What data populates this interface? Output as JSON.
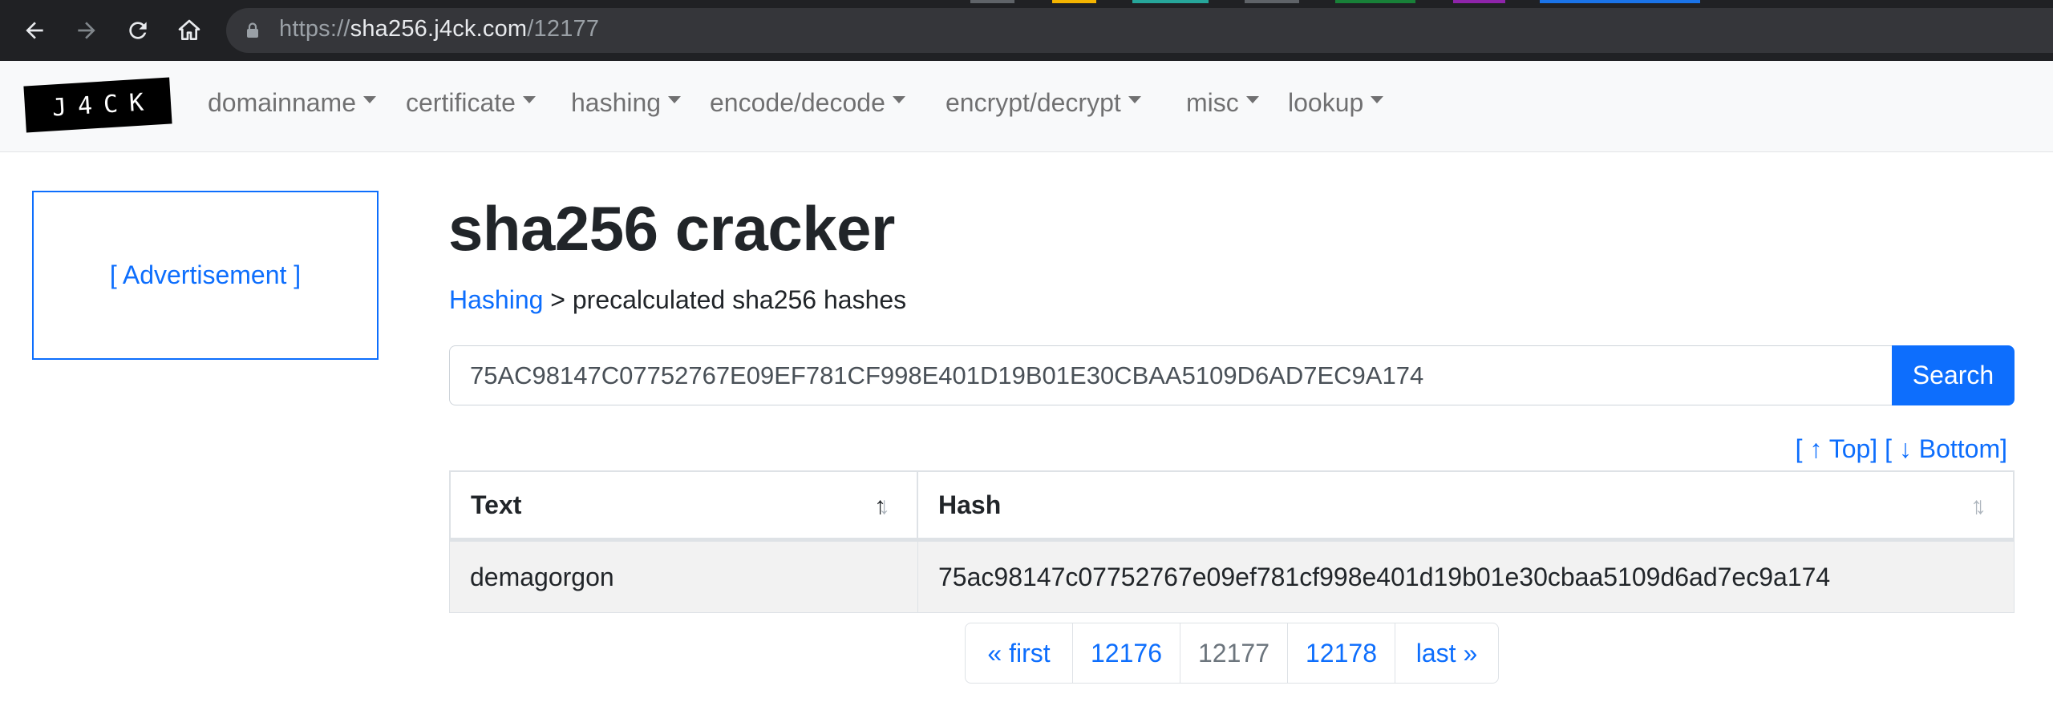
{
  "browser": {
    "url_scheme": "https://",
    "url_host": "sha256.j4ck.com",
    "url_path": "/12177"
  },
  "navbar": {
    "logo": "J4CK",
    "menus": [
      "domainname",
      "certificate",
      "hashing",
      "encode/decode",
      "encrypt/decrypt",
      "misc",
      "lookup"
    ]
  },
  "sidebar": {
    "ad_label": "[ Advertisement ]"
  },
  "main": {
    "title": "sha256 cracker",
    "breadcrumb": {
      "link": "Hashing",
      "separator": " > ",
      "current": "precalculated sha256 hashes"
    },
    "search": {
      "value": "75AC98147C07752767E09EF781CF998E401D19B01E30CBAA5109D6AD7EC9A174",
      "button": "Search"
    },
    "jump": {
      "top": "[ ↑ Top]",
      "bottom": "[ ↓ Bottom]"
    },
    "table": {
      "headers": [
        "Text",
        "Hash"
      ],
      "rows": [
        [
          "demagorgon",
          "75ac98147c07752767e09ef781cf998e401d19b01e30cbaa5109d6ad7ec9a174"
        ]
      ]
    },
    "pagination": [
      "« first",
      "12176",
      "12177",
      "12178",
      "last »"
    ]
  },
  "colors": {
    "link": "#0d6efd",
    "chrome": "#202124",
    "navbar": "#f8f9fa"
  }
}
